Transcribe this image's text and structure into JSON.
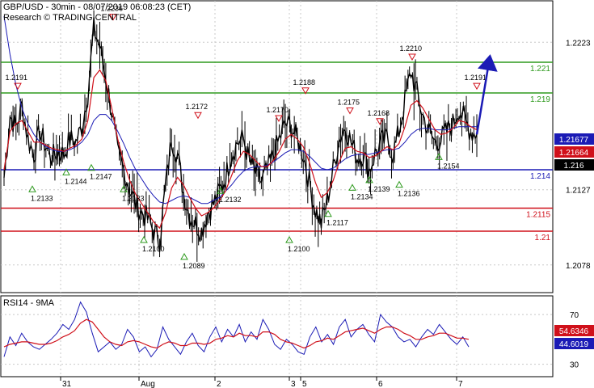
{
  "header": {
    "title": "GBP/USD - 30min - 08/07/2019 06:08:23 (CET)",
    "subtitle": "Research © TRADING CENTRAL"
  },
  "chart_data": [
    {
      "type": "candlestick",
      "instrument": "GBP/USD",
      "timeframe": "30min",
      "x_labels": [
        "31",
        "Aug",
        "2",
        "3",
        "5",
        "6",
        "7"
      ],
      "y_axis_labels": [
        "1.2223",
        "1.2127",
        "1.2078"
      ],
      "ylim": [
        1.206,
        1.225
      ],
      "grid": true,
      "levels": [
        {
          "label": "1.221",
          "value": 1.221,
          "color": "#2e9a1e"
        },
        {
          "label": "1.219",
          "value": 1.219,
          "color": "#2e9a1e"
        },
        {
          "label": "1.214",
          "value": 1.214,
          "color": "#1b1bb5"
        },
        {
          "label": "1.2115",
          "value": 1.2115,
          "color": "#d0101a"
        },
        {
          "label": "1.21",
          "value": 1.21,
          "color": "#d0101a"
        }
      ],
      "current_prices": [
        {
          "label": "1.21677",
          "value": 1.21677,
          "bg": "#1b1bb5",
          "fg": "#ffffff"
        },
        {
          "label": "1.21664",
          "value": 1.21664,
          "bg": "#d0101a",
          "fg": "#ffffff"
        },
        {
          "label": "1.216",
          "value": 1.216,
          "bg": "#000000",
          "fg": "#ffffff"
        }
      ],
      "peaks": [
        {
          "label": "1.2191",
          "value": 1.2191
        },
        {
          "label": "1.2236",
          "value": 1.2236
        },
        {
          "label": "1.2172",
          "value": 1.2172
        },
        {
          "label": "1.2170",
          "value": 1.217
        },
        {
          "label": "1.2188",
          "value": 1.2188
        },
        {
          "label": "1.2175",
          "value": 1.2175
        },
        {
          "label": "1.2168",
          "value": 1.2168
        },
        {
          "label": "1.2210",
          "value": 1.221
        },
        {
          "label": "1.2191",
          "value": 1.2191
        }
      ],
      "troughs": [
        {
          "label": "1.2133",
          "value": 1.2133
        },
        {
          "label": "1.2144",
          "value": 1.2144
        },
        {
          "label": "1.2147",
          "value": 1.2147
        },
        {
          "label": "1.2133",
          "value": 1.2133
        },
        {
          "label": "1.2100",
          "value": 1.21
        },
        {
          "label": "1.2089",
          "value": 1.2089
        },
        {
          "label": "1.2132",
          "value": 1.2132
        },
        {
          "label": "1.2100",
          "value": 1.21
        },
        {
          "label": "1.2117",
          "value": 1.2117
        },
        {
          "label": "1.2134",
          "value": 1.2134
        },
        {
          "label": "1.2139",
          "value": 1.2139
        },
        {
          "label": "1.2136",
          "value": 1.2136
        },
        {
          "label": "1.2154",
          "value": 1.2154
        }
      ],
      "close_path": [
        1.2135,
        1.2175,
        1.2168,
        1.2182,
        1.216,
        1.215,
        1.2165,
        1.2155,
        1.2148,
        1.2152,
        1.215,
        1.216,
        1.2158,
        1.2168,
        1.219,
        1.2232,
        1.222,
        1.22,
        1.2178,
        1.215,
        1.214,
        1.2128,
        1.2118,
        1.2112,
        1.2108,
        1.21,
        1.2094,
        1.213,
        1.216,
        1.215,
        1.2125,
        1.211,
        1.2105,
        1.21,
        1.2112,
        1.2118,
        1.2126,
        1.2135,
        1.215,
        1.2158,
        1.216,
        1.2145,
        1.2138,
        1.2132,
        1.214,
        1.215,
        1.216,
        1.217,
        1.2168,
        1.216,
        1.215,
        1.2132,
        1.2114,
        1.2105,
        1.212,
        1.214,
        1.216,
        1.2168,
        1.2158,
        1.2148,
        1.215,
        1.214,
        1.215,
        1.2158,
        1.216,
        1.215,
        1.2165,
        1.2185,
        1.2204,
        1.219,
        1.2175,
        1.2165,
        1.2158,
        1.216,
        1.2165,
        1.217,
        1.218,
        1.2172,
        1.2165,
        1.2163
      ],
      "ma_fast": [
        1.214,
        1.2165,
        1.217,
        1.2172,
        1.2165,
        1.2158,
        1.2158,
        1.2156,
        1.2154,
        1.2153,
        1.2152,
        1.2154,
        1.2156,
        1.216,
        1.2172,
        1.22,
        1.2205,
        1.2198,
        1.218,
        1.216,
        1.2145,
        1.2133,
        1.2124,
        1.2118,
        1.2112,
        1.2106,
        1.2102,
        1.2112,
        1.2128,
        1.2135,
        1.213,
        1.2122,
        1.2115,
        1.211,
        1.2112,
        1.2115,
        1.212,
        1.2126,
        1.2136,
        1.2146,
        1.2152,
        1.215,
        1.2146,
        1.2142,
        1.2142,
        1.2146,
        1.2152,
        1.216,
        1.2163,
        1.216,
        1.2155,
        1.2145,
        1.2132,
        1.2122,
        1.2125,
        1.2133,
        1.2145,
        1.2154,
        1.2155,
        1.2152,
        1.2151,
        1.2148,
        1.2149,
        1.2152,
        1.2155,
        1.2153,
        1.2157,
        1.2168,
        1.2182,
        1.2185,
        1.218,
        1.2173,
        1.2166,
        1.2163,
        1.2164,
        1.2167,
        1.2172,
        1.2171,
        1.2168,
        1.2166
      ],
      "ma_slow": [
        1.224,
        1.2215,
        1.2195,
        1.218,
        1.217,
        1.2163,
        1.2158,
        1.2155,
        1.2153,
        1.2152,
        1.2152,
        1.2153,
        1.2155,
        1.2158,
        1.2163,
        1.2172,
        1.2176,
        1.2176,
        1.2172,
        1.2165,
        1.2157,
        1.2148,
        1.214,
        1.2134,
        1.2128,
        1.2123,
        1.2119,
        1.2118,
        1.212,
        1.2122,
        1.2123,
        1.2122,
        1.212,
        1.2118,
        1.2118,
        1.212,
        1.2122,
        1.2126,
        1.213,
        1.2135,
        1.2139,
        1.2141,
        1.2142,
        1.2142,
        1.2143,
        1.2145,
        1.2148,
        1.2151,
        1.2153,
        1.2153,
        1.2152,
        1.2149,
        1.2145,
        1.2141,
        1.214,
        1.2141,
        1.2144,
        1.2147,
        1.2149,
        1.215,
        1.215,
        1.215,
        1.2151,
        1.2152,
        1.2153,
        1.2153,
        1.2154,
        1.2158,
        1.2163,
        1.2166,
        1.2167,
        1.2167,
        1.2166,
        1.2166,
        1.2166,
        1.2167,
        1.2168,
        1.2168,
        1.2168,
        1.2168
      ],
      "forecast": {
        "from": 1.2163,
        "to": 1.221
      }
    },
    {
      "type": "line",
      "title": "RSI14 - 9MA",
      "y_axis_labels": [
        "70",
        "30"
      ],
      "ylim": [
        20,
        85
      ],
      "series_labels": [
        {
          "label": "54.6346",
          "value": 54.6346,
          "bg": "#d0101a",
          "fg": "#ffffff"
        },
        {
          "label": "44.6019",
          "value": 44.6019,
          "bg": "#1b1bb5",
          "fg": "#ffffff"
        }
      ],
      "rsi": [
        36,
        52,
        45,
        55,
        48,
        44,
        42,
        46,
        50,
        55,
        62,
        58,
        66,
        80,
        72,
        55,
        40,
        44,
        48,
        42,
        46,
        58,
        52,
        40,
        44,
        36,
        42,
        60,
        50,
        44,
        38,
        48,
        55,
        45,
        40,
        52,
        60,
        48,
        58,
        52,
        62,
        48,
        56,
        50,
        66,
        58,
        46,
        42,
        50,
        46,
        40,
        38,
        52,
        60,
        48,
        54,
        46,
        60,
        66,
        52,
        58,
        62,
        54,
        48,
        70,
        64,
        60,
        52,
        48,
        50,
        44,
        52,
        58,
        54,
        62,
        56,
        50,
        46,
        52,
        44
      ],
      "rsi_ma": [
        44,
        46,
        47,
        48,
        48,
        47,
        46,
        46,
        47,
        49,
        52,
        54,
        57,
        63,
        66,
        64,
        58,
        52,
        48,
        46,
        45,
        48,
        49,
        48,
        46,
        44,
        43,
        46,
        48,
        47,
        45,
        45,
        47,
        47,
        46,
        47,
        50,
        51,
        53,
        52,
        55,
        53,
        53,
        52,
        56,
        56,
        54,
        50,
        48,
        47,
        45,
        43,
        45,
        48,
        49,
        51,
        50,
        53,
        56,
        57,
        58,
        59,
        57,
        55,
        58,
        60,
        60,
        58,
        55,
        53,
        50,
        50,
        52,
        53,
        55,
        55,
        53,
        51,
        51,
        50
      ]
    }
  ]
}
